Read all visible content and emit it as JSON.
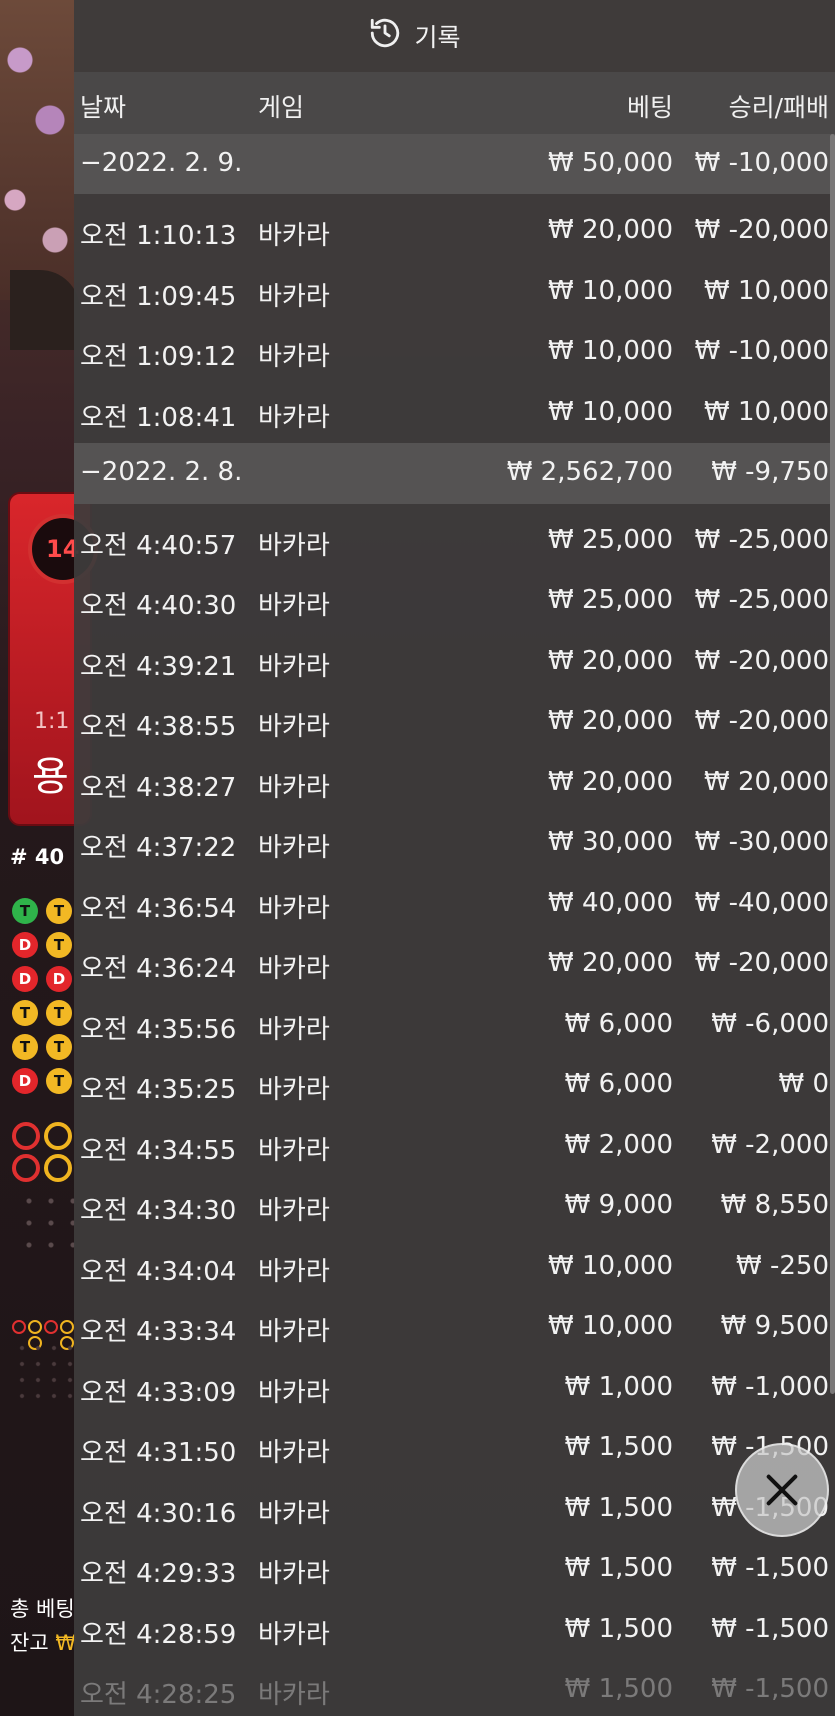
{
  "panel": {
    "title": "기록",
    "title_icon": "history-icon",
    "columns": {
      "date": "날짜",
      "game": "게임",
      "bet": "베팅",
      "result": "승리/패배"
    }
  },
  "groups": [
    {
      "date": "−2022. 2. 9.",
      "bet_total": "₩ 50,000",
      "result_total": "₩ -10,000",
      "rows": [
        {
          "time": "오전 1:10:13",
          "game": "바카라",
          "bet": "₩ 20,000",
          "result": "₩ -20,000"
        },
        {
          "time": "오전 1:09:45",
          "game": "바카라",
          "bet": "₩ 10,000",
          "result": "₩ 10,000"
        },
        {
          "time": "오전 1:09:12",
          "game": "바카라",
          "bet": "₩ 10,000",
          "result": "₩ -10,000"
        },
        {
          "time": "오전 1:08:41",
          "game": "바카라",
          "bet": "₩ 10,000",
          "result": "₩ 10,000"
        }
      ]
    },
    {
      "date": "−2022. 2. 8.",
      "bet_total": "₩ 2,562,700",
      "result_total": "₩ -9,750",
      "rows": [
        {
          "time": "오전 4:40:57",
          "game": "바카라",
          "bet": "₩ 25,000",
          "result": "₩ -25,000"
        },
        {
          "time": "오전 4:40:30",
          "game": "바카라",
          "bet": "₩ 25,000",
          "result": "₩ -25,000"
        },
        {
          "time": "오전 4:39:21",
          "game": "바카라",
          "bet": "₩ 20,000",
          "result": "₩ -20,000"
        },
        {
          "time": "오전 4:38:55",
          "game": "바카라",
          "bet": "₩ 20,000",
          "result": "₩ -20,000"
        },
        {
          "time": "오전 4:38:27",
          "game": "바카라",
          "bet": "₩ 20,000",
          "result": "₩ 20,000"
        },
        {
          "time": "오전 4:37:22",
          "game": "바카라",
          "bet": "₩ 30,000",
          "result": "₩ -30,000"
        },
        {
          "time": "오전 4:36:54",
          "game": "바카라",
          "bet": "₩ 40,000",
          "result": "₩ -40,000"
        },
        {
          "time": "오전 4:36:24",
          "game": "바카라",
          "bet": "₩ 20,000",
          "result": "₩ -20,000"
        },
        {
          "time": "오전 4:35:56",
          "game": "바카라",
          "bet": "₩ 6,000",
          "result": "₩ -6,000"
        },
        {
          "time": "오전 4:35:25",
          "game": "바카라",
          "bet": "₩ 6,000",
          "result": "₩ 0"
        },
        {
          "time": "오전 4:34:55",
          "game": "바카라",
          "bet": "₩ 2,000",
          "result": "₩ -2,000"
        },
        {
          "time": "오전 4:34:30",
          "game": "바카라",
          "bet": "₩ 9,000",
          "result": "₩ 8,550"
        },
        {
          "time": "오전 4:34:04",
          "game": "바카라",
          "bet": "₩ 10,000",
          "result": "₩ -250"
        },
        {
          "time": "오전 4:33:34",
          "game": "바카라",
          "bet": "₩ 10,000",
          "result": "₩ 9,500"
        },
        {
          "time": "오전 4:33:09",
          "game": "바카라",
          "bet": "₩ 1,000",
          "result": "₩ -1,000"
        },
        {
          "time": "오전 4:31:50",
          "game": "바카라",
          "bet": "₩ 1,500",
          "result": "₩ -1,500"
        },
        {
          "time": "오전 4:30:16",
          "game": "바카라",
          "bet": "₩ 1,500",
          "result": "₩ -1,500"
        },
        {
          "time": "오전 4:29:33",
          "game": "바카라",
          "bet": "₩ 1,500",
          "result": "₩ -1,500"
        },
        {
          "time": "오전 4:28:59",
          "game": "바카라",
          "bet": "₩ 1,500",
          "result": "₩ -1,500"
        },
        {
          "time": "오전 4:28:25",
          "game": "바카라",
          "bet": "₩ 1,500",
          "result": "₩ -1,500"
        }
      ]
    }
  ],
  "background": {
    "timer_value": "14",
    "bet_ratio": "1:1",
    "bet_label": "용",
    "round_label": "# 40",
    "road_labels": {
      "t": "T",
      "d": "D"
    },
    "total_bet_label": "총 베팅",
    "balance_label": "잔고",
    "currency": "₩"
  },
  "close_button": {
    "icon": "close-icon"
  },
  "colors": {
    "panel_bg": "#3e3c3c",
    "date_row_bg": "#555353",
    "header_bg": "#4a4848",
    "bet_card_red": "#d9262b"
  }
}
